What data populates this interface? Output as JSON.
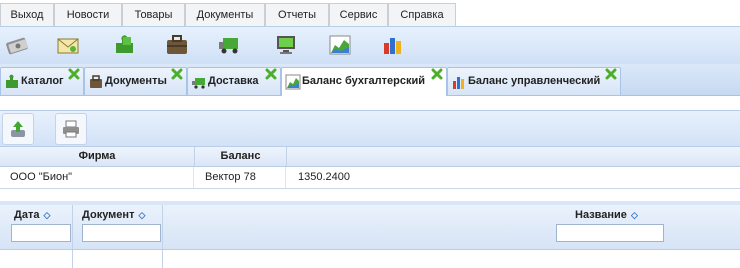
{
  "menu": [
    "Выход",
    "Новости",
    "Товары",
    "Документы",
    "Отчеты",
    "Сервис",
    "Справка"
  ],
  "toolbar_icons": [
    "money-icon",
    "mail-icon",
    "puzzle-icon",
    "briefcase-icon",
    "truck-icon",
    "monitor-icon",
    "area-chart-icon",
    "bar-chart-icon"
  ],
  "tabs": [
    {
      "label": "Каталог",
      "icon": "puzzle-icon",
      "active": false
    },
    {
      "label": "Документы",
      "icon": "briefcase-icon",
      "active": false
    },
    {
      "label": "Доставка",
      "icon": "truck-icon",
      "active": false
    },
    {
      "label": "Баланс бухгалтерский",
      "icon": "area-chart-icon",
      "active": true
    },
    {
      "label": "Баланс управленческий",
      "icon": "bar-chart-icon",
      "active": false
    }
  ],
  "actions": [
    "export-icon",
    "print-icon"
  ],
  "balance_table": {
    "columns": [
      "Фирма",
      "Баланс",
      ""
    ],
    "rows": [
      [
        "ООО \"Бион\"",
        "Вектор 78",
        "1350.2400"
      ]
    ]
  },
  "documents_table": {
    "columns": [
      {
        "label": "Дата",
        "sortable": true
      },
      {
        "label": "Документ",
        "sortable": true
      },
      {
        "label": "Название",
        "sortable": true
      }
    ],
    "filters": {
      "date": "",
      "document": "",
      "name": ""
    }
  },
  "colors": {
    "close_green": "#4caf2a",
    "header_blue": "#d6e4f6",
    "accent_blue": "#3d79c4"
  }
}
